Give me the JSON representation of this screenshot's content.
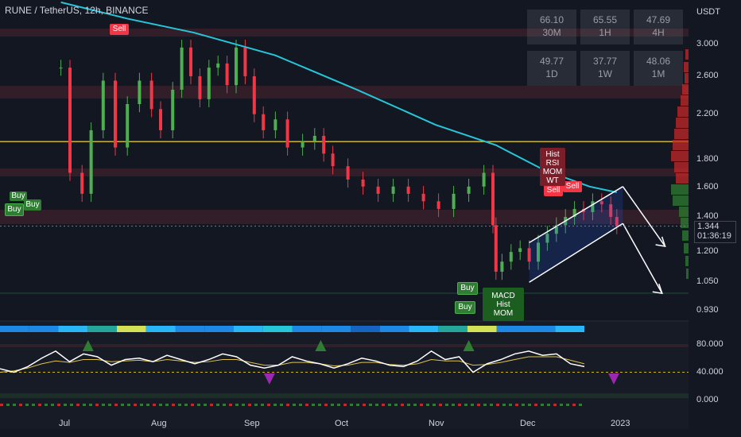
{
  "header": {
    "title": "RUNE / TetherUS, 12h, BINANCE"
  },
  "rsi_table": [
    {
      "value": "66.10",
      "tf": "30M"
    },
    {
      "value": "65.55",
      "tf": "1H"
    },
    {
      "value": "47.69",
      "tf": "4H"
    },
    {
      "value": "49.77",
      "tf": "1D"
    },
    {
      "value": "37.77",
      "tf": "1W"
    },
    {
      "value": "48.06",
      "tf": "1M"
    }
  ],
  "price_axis": {
    "currency": "USDT",
    "ticks": [
      "3.000",
      "2.600",
      "2.200",
      "1.800",
      "1.600",
      "1.400",
      "1.200",
      "1.050",
      "0.930"
    ]
  },
  "osc_axis": {
    "ticks": [
      "80.000",
      "40.000",
      "0.000"
    ]
  },
  "current_price": {
    "price": "1.344",
    "countdown": "01:36:19"
  },
  "time_axis": {
    "labels": [
      "Jul",
      "Aug",
      "Sep",
      "Oct",
      "Nov",
      "Dec",
      "2023"
    ]
  },
  "signals": {
    "sell_labels": [
      "Sell",
      "Sell",
      "Sell"
    ],
    "buy_labels": [
      "Buy",
      "Buy",
      "Buy",
      "Buy",
      "Buy"
    ],
    "hist_box_top": [
      "Hist",
      "RSI",
      "MOM",
      "WT"
    ],
    "hist_box_bottom": [
      "MACD",
      "Hist",
      "MOM"
    ]
  },
  "colors": {
    "background": "#131722",
    "bull": "#4caf50",
    "bear": "#f23645",
    "ema": "#26c6da",
    "yellow_line": "#c8b42d",
    "channel": "#2962ff",
    "sell_label": "#f23645",
    "buy_label": "#2e7d32"
  },
  "chart_data": {
    "type": "candlestick",
    "symbol": "RUNE / TetherUS",
    "interval": "12h",
    "exchange": "BINANCE",
    "x_labels": [
      "Jul",
      "Aug",
      "Sep",
      "Oct",
      "Nov",
      "Dec",
      "2023"
    ],
    "price_ylim": [
      0.88,
      3.3
    ],
    "price_scale": "log",
    "close_series": [
      {
        "date": "2022-06-18",
        "close": 2.7
      },
      {
        "date": "2022-06-21",
        "close": 1.7
      },
      {
        "date": "2022-06-25",
        "close": 1.55
      },
      {
        "date": "2022-06-28",
        "close": 2.05
      },
      {
        "date": "2022-07-02",
        "close": 2.55
      },
      {
        "date": "2022-07-06",
        "close": 1.9
      },
      {
        "date": "2022-07-10",
        "close": 2.3
      },
      {
        "date": "2022-07-14",
        "close": 2.55
      },
      {
        "date": "2022-07-18",
        "close": 2.25
      },
      {
        "date": "2022-07-21",
        "close": 2.05
      },
      {
        "date": "2022-07-25",
        "close": 2.45
      },
      {
        "date": "2022-07-28",
        "close": 2.95
      },
      {
        "date": "2022-07-31",
        "close": 2.6
      },
      {
        "date": "2022-08-03",
        "close": 2.35
      },
      {
        "date": "2022-08-06",
        "close": 2.7
      },
      {
        "date": "2022-08-09",
        "close": 2.75
      },
      {
        "date": "2022-08-12",
        "close": 2.5
      },
      {
        "date": "2022-08-15",
        "close": 2.95
      },
      {
        "date": "2022-08-18",
        "close": 2.6
      },
      {
        "date": "2022-08-21",
        "close": 2.2
      },
      {
        "date": "2022-08-24",
        "close": 2.05
      },
      {
        "date": "2022-08-28",
        "close": 2.15
      },
      {
        "date": "2022-09-01",
        "close": 1.9
      },
      {
        "date": "2022-09-06",
        "close": 1.95
      },
      {
        "date": "2022-09-10",
        "close": 2.0
      },
      {
        "date": "2022-09-13",
        "close": 1.85
      },
      {
        "date": "2022-09-16",
        "close": 1.75
      },
      {
        "date": "2022-09-21",
        "close": 1.65
      },
      {
        "date": "2022-09-26",
        "close": 1.6
      },
      {
        "date": "2022-10-01",
        "close": 1.55
      },
      {
        "date": "2022-10-06",
        "close": 1.6
      },
      {
        "date": "2022-10-11",
        "close": 1.55
      },
      {
        "date": "2022-10-16",
        "close": 1.5
      },
      {
        "date": "2022-10-21",
        "close": 1.45
      },
      {
        "date": "2022-10-26",
        "close": 1.55
      },
      {
        "date": "2022-10-31",
        "close": 1.6
      },
      {
        "date": "2022-11-05",
        "close": 1.7
      },
      {
        "date": "2022-11-08",
        "close": 1.35
      },
      {
        "date": "2022-11-09",
        "close": 1.1
      },
      {
        "date": "2022-11-11",
        "close": 1.15
      },
      {
        "date": "2022-11-14",
        "close": 1.2
      },
      {
        "date": "2022-11-17",
        "close": 1.22
      },
      {
        "date": "2022-11-20",
        "close": 1.15
      },
      {
        "date": "2022-11-23",
        "close": 1.25
      },
      {
        "date": "2022-11-26",
        "close": 1.3
      },
      {
        "date": "2022-11-29",
        "close": 1.35
      },
      {
        "date": "2022-12-02",
        "close": 1.4
      },
      {
        "date": "2022-12-05",
        "close": 1.45
      },
      {
        "date": "2022-12-08",
        "close": 1.43
      },
      {
        "date": "2022-12-11",
        "close": 1.5
      },
      {
        "date": "2022-12-14",
        "close": 1.48
      },
      {
        "date": "2022-12-17",
        "close": 1.4
      },
      {
        "date": "2022-12-19",
        "close": 1.344
      }
    ],
    "ema_series": [
      {
        "date": "2022-06-18",
        "value": 3.6
      },
      {
        "date": "2022-07-10",
        "value": 3.35
      },
      {
        "date": "2022-08-01",
        "value": 3.15
      },
      {
        "date": "2022-08-28",
        "value": 2.85
      },
      {
        "date": "2022-09-24",
        "value": 2.45
      },
      {
        "date": "2022-10-20",
        "value": 2.1
      },
      {
        "date": "2022-11-09",
        "value": 1.92
      },
      {
        "date": "2022-11-25",
        "value": 1.72
      },
      {
        "date": "2022-12-10",
        "value": 1.6
      },
      {
        "date": "2022-12-19",
        "value": 1.56
      }
    ],
    "horizontal_levels": [
      1.95
    ],
    "channel": {
      "lower": [
        {
          "date": "2022-11-20",
          "value": 1.05
        },
        {
          "date": "2022-12-21",
          "value": 1.36
        }
      ],
      "upper": [
        {
          "date": "2022-11-20",
          "value": 1.25
        },
        {
          "date": "2022-12-21",
          "value": 1.6
        }
      ]
    },
    "projection_arrows": [
      {
        "from": {
          "date": "2022-12-21",
          "value": 1.6
        },
        "to": {
          "date": "2023-01-04",
          "value": 1.23
        }
      },
      {
        "from": {
          "date": "2022-12-21",
          "value": 1.36
        },
        "to": {
          "date": "2023-01-03",
          "value": 1.0
        }
      }
    ],
    "oscillator": {
      "ylim": [
        -10,
        100
      ],
      "ticks": [
        80,
        40,
        0
      ],
      "dashed_level": 40,
      "white_series": [
        45,
        40,
        48,
        60,
        70,
        55,
        66,
        62,
        50,
        58,
        60,
        55,
        64,
        58,
        52,
        58,
        66,
        62,
        50,
        46,
        50,
        62,
        56,
        52,
        46,
        52,
        60,
        56,
        50,
        48,
        56,
        70,
        58,
        62,
        40,
        52,
        58,
        66,
        70,
        64,
        66,
        52,
        48
      ],
      "yellow_series": [
        40,
        42,
        46,
        52,
        56,
        54,
        58,
        58,
        55,
        56,
        57,
        55,
        58,
        56,
        54,
        55,
        58,
        58,
        54,
        50,
        50,
        54,
        54,
        52,
        49,
        50,
        54,
        54,
        51,
        50,
        52,
        58,
        56,
        56,
        50,
        51,
        54,
        58,
        62,
        62,
        62,
        57,
        52
      ],
      "up_triangles_dates": [
        "2022-06-27",
        "2022-09-12",
        "2022-10-31"
      ],
      "down_triangles_dates": [
        "2022-08-26",
        "2022-12-18"
      ]
    }
  }
}
